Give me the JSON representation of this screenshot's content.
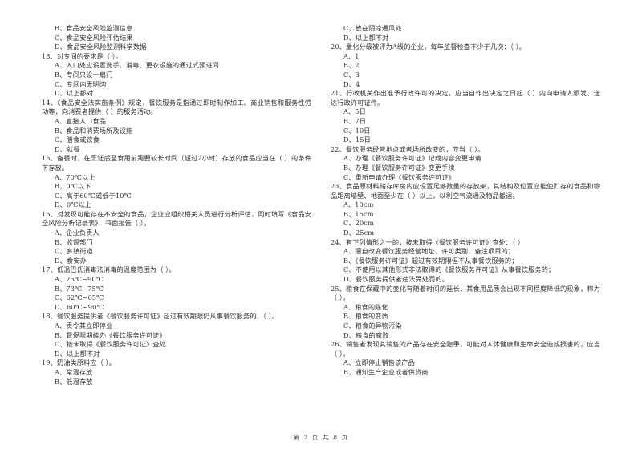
{
  "document": {
    "page_footer": "第 2 页  共 8 页",
    "page_number": "2",
    "total_pages": "8"
  },
  "left_column": [
    {
      "type": "option",
      "text": "B、食品安全风险监测信息"
    },
    {
      "type": "option",
      "text": "C、食品安全风险评估结果"
    },
    {
      "type": "option",
      "text": "D、食品安全风险监测科学数据"
    },
    {
      "type": "stem",
      "text": "13、对专间的要求是（      ）。"
    },
    {
      "type": "option",
      "text": "A、入口处应设置洗手、消毒、更衣设施的通过式预进间"
    },
    {
      "type": "option",
      "text": "B、专间只设一扇门"
    },
    {
      "type": "option",
      "text": "C、专间内无明沟"
    },
    {
      "type": "option",
      "text": "D、以上都对"
    },
    {
      "type": "stem",
      "text": "14、《食品安全法实施条例》规定，餐饮服务是指通过即时制作加工、商业销售和服务性劳动等，向消费者提供（      ）的服务活动。"
    },
    {
      "type": "option",
      "text": "A、直接入口食品"
    },
    {
      "type": "option",
      "text": "B、食品和消费场所及设施"
    },
    {
      "type": "option",
      "text": "C、膳食或饮食"
    },
    {
      "type": "option",
      "text": "D、就餐"
    },
    {
      "type": "stem",
      "text": "15、备餐时，在烹饪后至食用前需要较长时间（超过2小时）存放的食品应当在（        ）的条件下存放。"
    },
    {
      "type": "option",
      "text": "A、70℃以上"
    },
    {
      "type": "option",
      "text": "B、0℃以下"
    },
    {
      "type": "option",
      "text": "C、高于60℃或低于10℃"
    },
    {
      "type": "option",
      "text": "D、0℃以上"
    },
    {
      "type": "stem",
      "text": "16、对发现可能存在不安全的食品，企业应组织相关人员进行分析评估，同时填写《食品安全风险分析记录表》，书面报告（        ）。"
    },
    {
      "type": "option",
      "text": "A、企业负责人"
    },
    {
      "type": "option",
      "text": "B、监督部门"
    },
    {
      "type": "option",
      "text": "C、乡镇街道"
    },
    {
      "type": "option",
      "text": "D、食安办"
    },
    {
      "type": "stem",
      "text": "17、低温巴氏消毒法消毒的温度范围为（      ）。"
    },
    {
      "type": "option",
      "text": "A、75℃~90℃"
    },
    {
      "type": "option",
      "text": "B、73℃~75℃"
    },
    {
      "type": "option",
      "text": "C、62℃~65℃"
    },
    {
      "type": "option",
      "text": "D、60℃~90℃"
    },
    {
      "type": "stem",
      "text": "18、餐饮服务提供者《餐饮服务许可证》超过有效期限仍从事餐饮服务的，（      ）。"
    },
    {
      "type": "option",
      "text": "A、责令其立即停业"
    },
    {
      "type": "option",
      "text": "B、督促限期续办《餐饮服务许可证》"
    },
    {
      "type": "option",
      "text": "C、按未取得《餐饮服务许可证》查处"
    },
    {
      "type": "option",
      "text": "D、以上都不对"
    },
    {
      "type": "stem",
      "text": "19、奶油类原料应（      ）。"
    },
    {
      "type": "option",
      "text": "A、常温存放"
    },
    {
      "type": "option",
      "text": "B、低温存放"
    }
  ],
  "right_column": [
    {
      "type": "option",
      "text": "C、放在阴凉通风处"
    },
    {
      "type": "option",
      "text": "D、以上都不对"
    },
    {
      "type": "stem",
      "text": "20、量化分级被评为A级的企业，每年监督检查不少于几次：（      ）。"
    },
    {
      "type": "option",
      "text": "A、1"
    },
    {
      "type": "option",
      "text": "B、2"
    },
    {
      "type": "option",
      "text": "C、3"
    },
    {
      "type": "option",
      "text": "D、4"
    },
    {
      "type": "stem",
      "text": "21、行政机关作出准予行政许可的决定，应当自作出决定之日起（      ）内向申请人颁发、送达行政许可证件。"
    },
    {
      "type": "option",
      "text": "A、5日"
    },
    {
      "type": "option",
      "text": "B、7日"
    },
    {
      "type": "option",
      "text": "C、10日"
    },
    {
      "type": "option",
      "text": "D、15日"
    },
    {
      "type": "stem",
      "text": "22、餐饮服务经营地点或者场所改变的，应当（      ）。"
    },
    {
      "type": "option",
      "text": "A、办理《餐饮服务许可证》记载内容变更申请"
    },
    {
      "type": "option",
      "text": "B、办理《餐饮服务许可证》变更手续"
    },
    {
      "type": "option",
      "text": "C、重新申请办理《餐饮服务许可证》"
    },
    {
      "type": "stem",
      "text": "23、食品原材料储存库房内应设置足够数量的存放架，其结构及位置应能使贮存的食品和物品距离墙壁、地面至少在（      ）以上，以利空气流通及物品搬运。"
    },
    {
      "type": "option",
      "text": "A、10cm"
    },
    {
      "type": "option",
      "text": "B、15cm"
    },
    {
      "type": "option",
      "text": "C、20cm"
    },
    {
      "type": "option",
      "text": "D、25cm"
    },
    {
      "type": "stem",
      "text": "24、有下列情形之一的，按未取得《餐饮服务许可证》查处：（      ）"
    },
    {
      "type": "option",
      "text": "A、擅自改变餐饮服务经营地址、许可类别、备注项目的；"
    },
    {
      "type": "option",
      "text": "B、《餐饮服务许可证》超过有效期限但不从事餐饮服务的；"
    },
    {
      "type": "option",
      "text": "C、不使用以其他形式非法取得的《餐饮服务许可证》从事餐饮服务的；"
    },
    {
      "type": "option",
      "text": "D、餐饮服务提供者违法受处罚的。"
    },
    {
      "type": "stem",
      "text": "25、粮食在保藏中的变化有随着时间的延长，其食用品质会出现不同程度降低的现象，称为（      ）。"
    },
    {
      "type": "option",
      "text": "A、粮食的陈化"
    },
    {
      "type": "option",
      "text": "B、粮食的变质"
    },
    {
      "type": "option",
      "text": "C、粮食的异物污染"
    },
    {
      "type": "option",
      "text": "D、粮食的腐败"
    },
    {
      "type": "stem",
      "text": "26、销售者发现其销售的产品存在安全隐患，可能对人体健康和生命安全造成损害的，应当（      ）。"
    },
    {
      "type": "option",
      "text": "A、立即停止销售该产品"
    },
    {
      "type": "option",
      "text": "B、通知生产企业或者供货商"
    }
  ]
}
